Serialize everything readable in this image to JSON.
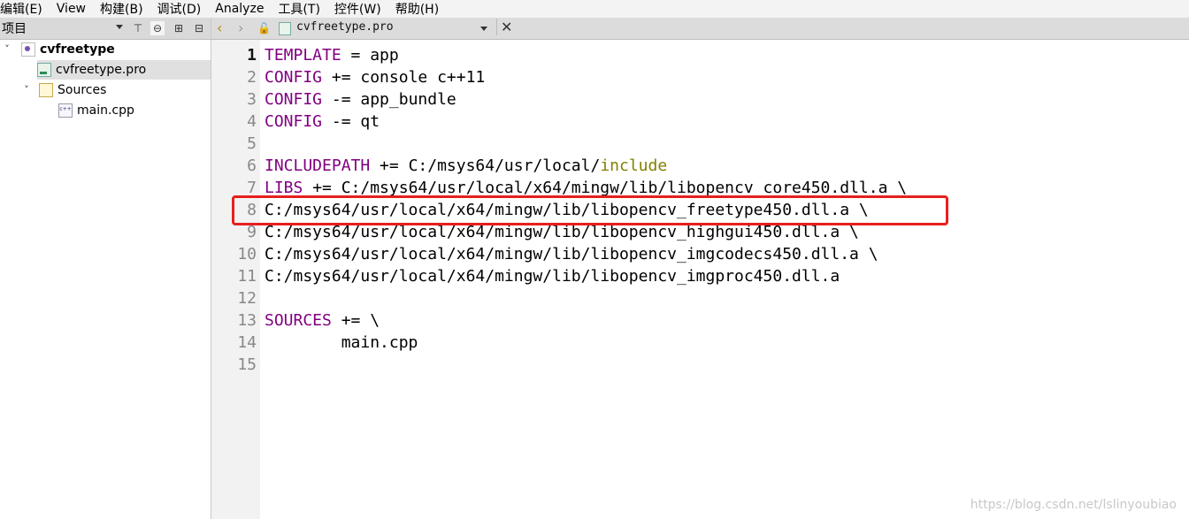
{
  "menu": [
    "编辑(E)",
    "View",
    "构建(B)",
    "调试(D)",
    "Analyze",
    "工具(T)",
    "控件(W)",
    "帮助(H)"
  ],
  "project_panel": {
    "title": "项目",
    "tree": {
      "project": "cvfreetype",
      "pro_file": "cvfreetype.pro",
      "sources_folder": "Sources",
      "source_file": "main.cpp"
    }
  },
  "editor": {
    "tab_filename": "cvfreetype.pro",
    "current_line": "1",
    "lines": [
      {
        "num": "1",
        "parts": [
          {
            "t": "TEMPLATE",
            "c": "kw"
          },
          {
            "t": " = app",
            "c": ""
          }
        ]
      },
      {
        "num": "2",
        "parts": [
          {
            "t": "CONFIG",
            "c": "kw"
          },
          {
            "t": " += console c++11",
            "c": ""
          }
        ]
      },
      {
        "num": "3",
        "parts": [
          {
            "t": "CONFIG",
            "c": "kw"
          },
          {
            "t": " -= app_bundle",
            "c": ""
          }
        ]
      },
      {
        "num": "4",
        "parts": [
          {
            "t": "CONFIG",
            "c": "kw"
          },
          {
            "t": " -= qt",
            "c": ""
          }
        ]
      },
      {
        "num": "5",
        "parts": [
          {
            "t": "",
            "c": ""
          }
        ]
      },
      {
        "num": "6",
        "parts": [
          {
            "t": "INCLUDEPATH",
            "c": "kw"
          },
          {
            "t": " += C:/msys64/usr/local/",
            "c": ""
          },
          {
            "t": "include",
            "c": "ol"
          }
        ]
      },
      {
        "num": "7",
        "parts": [
          {
            "t": "LIBS",
            "c": "kw"
          },
          {
            "t": " += C:/msys64/usr/local/x64/mingw/lib/libopencv_core450.dll.a \\",
            "c": ""
          }
        ]
      },
      {
        "num": "8",
        "parts": [
          {
            "t": "C:/msys64/usr/local/x64/mingw/lib/libopencv_freetype450.dll.a \\",
            "c": ""
          }
        ]
      },
      {
        "num": "9",
        "parts": [
          {
            "t": "C:/msys64/usr/local/x64/mingw/lib/libopencv_highgui450.dll.a \\",
            "c": ""
          }
        ]
      },
      {
        "num": "10",
        "parts": [
          {
            "t": "C:/msys64/usr/local/x64/mingw/lib/libopencv_imgcodecs450.dll.a \\",
            "c": ""
          }
        ]
      },
      {
        "num": "11",
        "parts": [
          {
            "t": "C:/msys64/usr/local/x64/mingw/lib/libopencv_imgproc450.dll.a",
            "c": ""
          }
        ]
      },
      {
        "num": "12",
        "parts": [
          {
            "t": "",
            "c": ""
          }
        ]
      },
      {
        "num": "13",
        "parts": [
          {
            "t": "SOURCES",
            "c": "kw"
          },
          {
            "t": " += \\",
            "c": ""
          }
        ]
      },
      {
        "num": "14",
        "parts": [
          {
            "t": "        main.cpp",
            "c": ""
          }
        ]
      },
      {
        "num": "15",
        "parts": [
          {
            "t": "",
            "c": ""
          }
        ]
      }
    ]
  },
  "icons": {
    "nav_back": "chevron-left-icon",
    "nav_forward": "chevron-right-icon",
    "lock": "lock-icon",
    "close": "close-icon",
    "filter": "filter-icon",
    "link": "link-icon",
    "split": "split-icon",
    "collapse": "collapse-icon"
  },
  "colors": {
    "keyword": "#800080",
    "olive": "#808000",
    "highlight_box": "#e81f1f"
  },
  "watermark": "https://blog.csdn.net/lslinyoubiao"
}
